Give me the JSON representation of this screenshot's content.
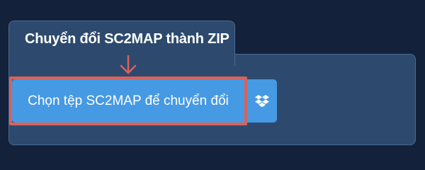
{
  "tab": {
    "title": "Chuyển đổi SC2MAP thành ZIP"
  },
  "upload": {
    "choose_label": "Chọn tệp SC2MAP để chuyển đổi",
    "dropbox_icon": "dropbox-icon"
  },
  "annotation": {
    "arrow_icon": "arrow-down-icon",
    "highlight_color": "#d9625a"
  },
  "colors": {
    "background": "#14213a",
    "panel": "#2d4a6e",
    "button": "#4699e3",
    "accent": "#d9625a"
  }
}
